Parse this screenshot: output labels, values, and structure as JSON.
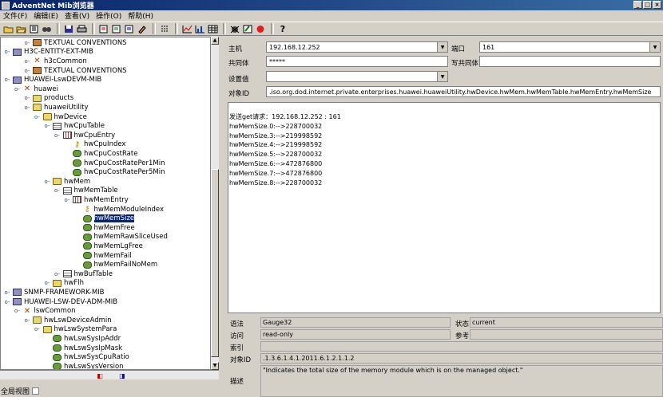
{
  "window": {
    "title": "AdventNet Mib浏览器"
  },
  "menu": [
    "文件(F)",
    "编辑(E)",
    "查看(V)",
    "操作(O)",
    "帮助(H)"
  ],
  "toolbar": {
    "icons": [
      "open-icon",
      "open-folder-icon",
      "save-module-icon",
      "find-icon",
      "save-icon",
      "print-icon",
      "get-icon",
      "getnext-icon",
      "getbulk-icon",
      "set-icon",
      "table-view-icon",
      "graph-icon",
      "multi-varbind-icon",
      "trap-icon",
      "edit-icon",
      "stop-icon",
      "help-icon"
    ],
    "help_label": "?"
  },
  "tree": [
    {
      "label": "TEXTUAL CONVENTIONS",
      "icon": "textconv",
      "depth": 2,
      "handle": "o-"
    },
    {
      "label": "H3C-ENTITY-EXT-MIB",
      "icon": "module",
      "depth": 0,
      "handle": "o-"
    },
    {
      "label": "h3cCommon",
      "icon": "x",
      "depth": 2,
      "handle": "o-"
    },
    {
      "label": "TEXTUAL CONVENTIONS",
      "icon": "textconv",
      "depth": 2,
      "handle": "o-"
    },
    {
      "label": "HUAWEI-LswDEVM-MIB",
      "icon": "module",
      "depth": 0,
      "handle": "o-"
    },
    {
      "label": "huawei",
      "icon": "x",
      "depth": 1,
      "handle": "o-"
    },
    {
      "label": "products",
      "icon": "folder",
      "depth": 2,
      "handle": "o-"
    },
    {
      "label": "huaweiUtility",
      "icon": "folder",
      "depth": 2,
      "handle": "o-"
    },
    {
      "label": "hwDevice",
      "icon": "folder",
      "depth": 3,
      "handle": "o-"
    },
    {
      "label": "hwCpuTable",
      "icon": "table",
      "depth": 4,
      "handle": "o-"
    },
    {
      "label": "hwCpuEntry",
      "icon": "entry",
      "depth": 5,
      "handle": "o-"
    },
    {
      "label": "hwCpuIndex",
      "icon": "key",
      "depth": 6,
      "handle": ""
    },
    {
      "label": "hwCpuCostRate",
      "icon": "leaf",
      "depth": 6,
      "handle": ""
    },
    {
      "label": "hwCpuCostRatePer1Min",
      "icon": "leaf",
      "depth": 6,
      "handle": ""
    },
    {
      "label": "hwCpuCostRatePer5Min",
      "icon": "leaf",
      "depth": 6,
      "handle": ""
    },
    {
      "label": "hwMem",
      "icon": "folder",
      "depth": 4,
      "handle": "o-"
    },
    {
      "label": "hwMemTable",
      "icon": "table",
      "depth": 5,
      "handle": "o-"
    },
    {
      "label": "hwMemEntry",
      "icon": "entry",
      "depth": 6,
      "handle": "o-"
    },
    {
      "label": "hwMemModuleIndex",
      "icon": "key",
      "depth": 7,
      "handle": ""
    },
    {
      "label": "hwMemSize",
      "icon": "leaf",
      "depth": 7,
      "handle": "",
      "selected": true
    },
    {
      "label": "hwMemFree",
      "icon": "leaf",
      "depth": 7,
      "handle": ""
    },
    {
      "label": "hwMemRawSliceUsed",
      "icon": "leaf",
      "depth": 7,
      "handle": ""
    },
    {
      "label": "hwMemLgFree",
      "icon": "leaf",
      "depth": 7,
      "handle": ""
    },
    {
      "label": "hwMemFail",
      "icon": "leaf",
      "depth": 7,
      "handle": ""
    },
    {
      "label": "hwMemFailNoMem",
      "icon": "leaf",
      "depth": 7,
      "handle": ""
    },
    {
      "label": "hwBufTable",
      "icon": "table",
      "depth": 5,
      "handle": "o-"
    },
    {
      "label": "hwFlh",
      "icon": "folder",
      "depth": 4,
      "handle": "o-"
    },
    {
      "label": "SNMP-FRAMEWORK-MIB",
      "icon": "module",
      "depth": 0,
      "handle": "o-"
    },
    {
      "label": "HUAWEI-LSW-DEV-ADM-MIB",
      "icon": "module",
      "depth": 0,
      "handle": "o-"
    },
    {
      "label": "lswCommon",
      "icon": "x",
      "depth": 1,
      "handle": "o-"
    },
    {
      "label": "hwLswDeviceAdmin",
      "icon": "folder",
      "depth": 2,
      "handle": "o-"
    },
    {
      "label": "hwLswSystemPara",
      "icon": "folder",
      "depth": 3,
      "handle": "o-"
    },
    {
      "label": "hwLswSysIpAddr",
      "icon": "leaf",
      "depth": 4,
      "handle": ""
    },
    {
      "label": "hwLswSysIpMask",
      "icon": "leaf",
      "depth": 4,
      "handle": ""
    },
    {
      "label": "hwLswSysCpuRatio",
      "icon": "leaf",
      "depth": 4,
      "handle": ""
    },
    {
      "label": "hwLswSysVersion",
      "icon": "leaf",
      "depth": 4,
      "handle": ""
    }
  ],
  "global_view_label": "全局视图",
  "form": {
    "host_label": "主机",
    "host_value": "192.168.12.252",
    "port_label": "端口",
    "port_value": "161",
    "community_label": "共同体",
    "community_value": "*****",
    "write_community_label": "写共同体",
    "write_community_value": "",
    "set_value_label": "设置值",
    "set_value_value": "",
    "oid_label": "对象ID",
    "oid_value": ".iso.org.dod.internet.private.enterprises.huawei.huaweiUtility.hwDevice.hwMem.hwMemTable.hwMemEntry.hwMemSize"
  },
  "results": [
    "发送get请求：192.168.12.252 : 161",
    "hwMemSize.0:-->228700032",
    "hwMemSize.3:-->219998592",
    "hwMemSize.4:-->219998592",
    "hwMemSize.5:-->228700032",
    "hwMemSize.6:-->472876800",
    "hwMemSize.7:-->472876800",
    "hwMemSize.8:-->228700032"
  ],
  "info": {
    "syntax_label": "语法",
    "syntax_value": "Gauge32",
    "status_label": "状态",
    "status_value": "current",
    "access_label": "访问",
    "access_value": "read-only",
    "reference_label": "参考",
    "reference_value": "",
    "index_label": "索引",
    "index_value": "",
    "oid_label": "对象ID",
    "oid_value": ".1.3.6.1.4.1.2011.6.1.2.1.1.2",
    "desc_label": "描述",
    "desc_value": "\"Indicates the total size of the memory module which is on the managed object.\""
  }
}
